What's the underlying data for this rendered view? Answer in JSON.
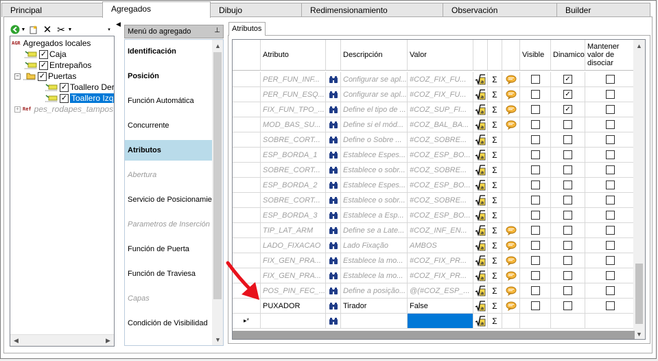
{
  "tabs": [
    {
      "label": "Principal",
      "active": false
    },
    {
      "label": "Agregados",
      "active": true
    },
    {
      "label": "Dibujo",
      "active": false
    },
    {
      "label": "Redimensionamiento",
      "active": false
    },
    {
      "label": "Observación",
      "active": false
    },
    {
      "label": "Builder",
      "active": false
    }
  ],
  "tree": {
    "root_tag": "AGR",
    "root_label": "Agregados locales",
    "items": [
      {
        "label": "Caja",
        "checked": true
      },
      {
        "label": "Entrepaños",
        "checked": true
      },
      {
        "label": "Puertas",
        "checked": true
      },
      {
        "label": "Toallero Der",
        "checked": true
      },
      {
        "label": "Toallero Izq",
        "checked": true,
        "selected": true
      }
    ],
    "ref_tag": "Ref",
    "ref_label": "pes_rodapes_tampos"
  },
  "menu": {
    "header": "Menú do agregado",
    "pin_icon": "pin-icon",
    "items": [
      {
        "label": "Identificación",
        "style": "bold"
      },
      {
        "label": "Posición",
        "style": "bold"
      },
      {
        "label": "Función Automática",
        "style": "normal"
      },
      {
        "label": "Concurrente",
        "style": "normal"
      },
      {
        "label": "Atributos",
        "style": "bold-active"
      },
      {
        "label": "Abertura",
        "style": "disabled"
      },
      {
        "label": "Servicio de Posicionamiento",
        "style": "normal"
      },
      {
        "label": "Parametros de Inserción",
        "style": "disabled"
      },
      {
        "label": "Función de Puerta",
        "style": "normal"
      },
      {
        "label": "Función de Traviesa",
        "style": "normal"
      },
      {
        "label": "Capas",
        "style": "disabled"
      },
      {
        "label": "Condición de Visibilidad",
        "style": "normal"
      }
    ]
  },
  "panel_tab": "Atributos",
  "grid": {
    "headers": {
      "atributo": "Atributo",
      "descripcion": "Descripción",
      "valor": "Valor",
      "visible": "Visible",
      "dinamico": "Dinamico",
      "mantener": "Mantener valor de disociar"
    },
    "rows": [
      {
        "atributo": "PER_FUN_INF...",
        "descripcion": "Configurar se apl...",
        "valor": "#COZ_FIX_FU...",
        "note": true,
        "visible": false,
        "dinamico": true,
        "mantener": false,
        "greyed": true
      },
      {
        "atributo": "PER_FUN_ESQ...",
        "descripcion": "Configurar se apl...",
        "valor": "#COZ_FIX_FU...",
        "note": true,
        "visible": false,
        "dinamico": true,
        "mantener": false,
        "greyed": true
      },
      {
        "atributo": "FIX_FUN_TPO_...",
        "descripcion": "Define el tipo de ...",
        "valor": "#COZ_SUP_FI...",
        "note": true,
        "visible": false,
        "dinamico": true,
        "mantener": false,
        "greyed": true
      },
      {
        "atributo": "MOD_BAS_SU...",
        "descripcion": "Define si el mód...",
        "valor": "#COZ_BAL_BA...",
        "note": true,
        "visible": false,
        "dinamico": false,
        "mantener": false,
        "greyed": true
      },
      {
        "atributo": "SOBRE_CORT...",
        "descripcion": "Define o Sobre ...",
        "valor": "#COZ_SOBRE...",
        "note": false,
        "visible": false,
        "dinamico": false,
        "mantener": false,
        "greyed": true
      },
      {
        "atributo": "ESP_BORDA_1",
        "descripcion": "Establece Espes...",
        "valor": "#COZ_ESP_BO...",
        "note": false,
        "visible": false,
        "dinamico": false,
        "mantener": false,
        "greyed": true
      },
      {
        "atributo": "SOBRE_CORT...",
        "descripcion": "Establece o sobr...",
        "valor": "#COZ_SOBRE...",
        "note": false,
        "visible": false,
        "dinamico": false,
        "mantener": false,
        "greyed": true
      },
      {
        "atributo": "ESP_BORDA_2",
        "descripcion": "Establece Espes...",
        "valor": "#COZ_ESP_BO...",
        "note": false,
        "visible": false,
        "dinamico": false,
        "mantener": false,
        "greyed": true
      },
      {
        "atributo": "SOBRE_CORT...",
        "descripcion": "Establece o sobr...",
        "valor": "#COZ_SOBRE...",
        "note": false,
        "visible": false,
        "dinamico": false,
        "mantener": false,
        "greyed": true
      },
      {
        "atributo": "ESP_BORDA_3",
        "descripcion": "Establece a Esp...",
        "valor": "#COZ_ESP_BO...",
        "note": false,
        "visible": false,
        "dinamico": false,
        "mantener": false,
        "greyed": true
      },
      {
        "atributo": "TIP_LAT_ARM",
        "descripcion": "Define se a Late...",
        "valor": "#COZ_INF_EN...",
        "note": true,
        "visible": false,
        "dinamico": false,
        "mantener": false,
        "greyed": true
      },
      {
        "atributo": "LADO_FIXACAO",
        "descripcion": "Lado Fixação",
        "valor": "AMBOS",
        "note": true,
        "visible": false,
        "dinamico": false,
        "mantener": false,
        "greyed": true
      },
      {
        "atributo": "FIX_GEN_PRA...",
        "descripcion": "Establece la mo...",
        "valor": "#COZ_FIX_PR...",
        "note": true,
        "visible": false,
        "dinamico": false,
        "mantener": false,
        "greyed": true
      },
      {
        "atributo": "FIX_GEN_PRA...",
        "descripcion": "Establece la mo...",
        "valor": "#COZ_FIX_PR...",
        "note": true,
        "visible": false,
        "dinamico": false,
        "mantener": false,
        "greyed": true
      },
      {
        "atributo": "POS_PIN_FEC_...",
        "descripcion": "Define a posição...",
        "valor": "@(#COZ_ESP_...",
        "note": true,
        "visible": false,
        "dinamico": false,
        "mantener": false,
        "greyed": true
      },
      {
        "atributo": "PUXADOR",
        "descripcion": "Tirador",
        "valor": "False",
        "note": true,
        "visible": false,
        "dinamico": false,
        "mantener": false,
        "greyed": false
      }
    ],
    "new_row_marker": "▸*"
  },
  "colors": {
    "selection": "#0078d7",
    "menu_active": "#b9dbea",
    "annotation_arrow": "#e8121c"
  }
}
